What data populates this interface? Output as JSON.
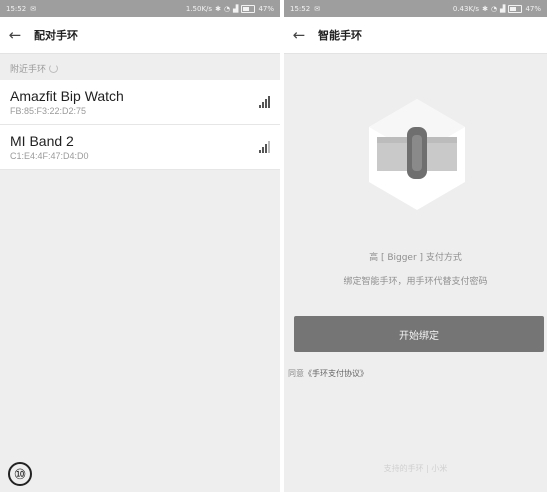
{
  "marker": "⑩",
  "left_screen": {
    "status": {
      "time": "15:52",
      "right": "1.50K/s",
      "battery": "47%"
    },
    "nav": {
      "back": "←",
      "title": "配对手环"
    },
    "section_label": "附近手环",
    "devices": [
      {
        "name": "Amazfit Bip Watch",
        "mac": "FB:85:F3:22:D2:75"
      },
      {
        "name": "MI Band 2",
        "mac": "C1:E4:4F:47:D4:D0"
      }
    ]
  },
  "right_screen": {
    "status": {
      "time": "15:52",
      "right": "0.43K/s",
      "battery": "47%"
    },
    "nav": {
      "back": "←",
      "title": "智能手环"
    },
    "promo_line1": "高 [ Bigger ] 支付方式",
    "promo_line2": "绑定智能手环，用手环代替支付密码",
    "bind_button": "开始绑定",
    "agree_prefix": "同意",
    "agree_link": "《手环支付协议》",
    "footer": "支持的手环 | 小米"
  },
  "colors": {
    "statusbar": "#9e9e9e",
    "button": "#757575",
    "background": "#eeeeee"
  }
}
